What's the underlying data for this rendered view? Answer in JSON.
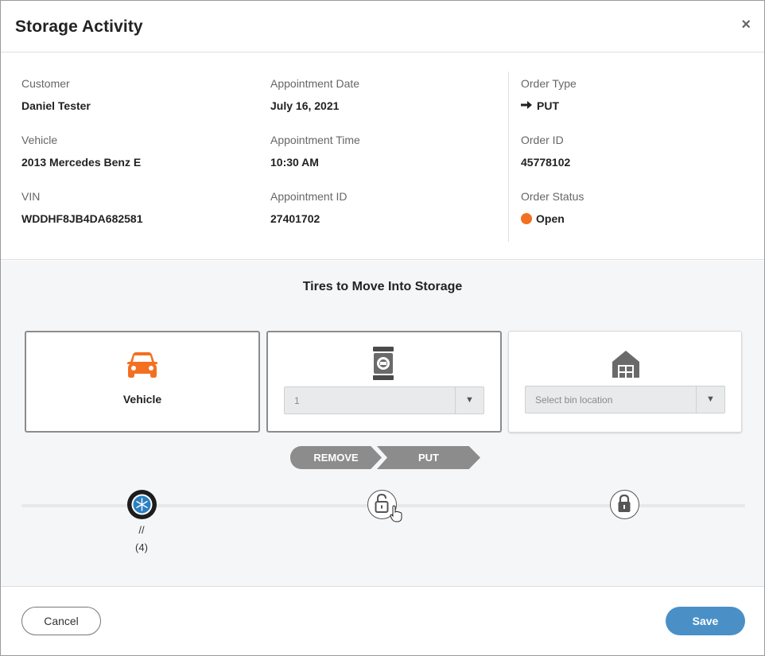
{
  "dialog": {
    "title": "Storage Activity",
    "close_icon": "×"
  },
  "details": {
    "customer_label": "Customer",
    "customer_value": "Daniel Tester",
    "vehicle_label": "Vehicle",
    "vehicle_value": "2013 Mercedes Benz E",
    "vin_label": "VIN",
    "vin_value": "WDDHF8JB4DA682581",
    "appt_date_label": "Appointment Date",
    "appt_date_value": "July 16, 2021",
    "appt_time_label": "Appointment Time",
    "appt_time_value": "10:30 AM",
    "appt_id_label": "Appointment ID",
    "appt_id_value": "27401702",
    "order_type_label": "Order Type",
    "order_type_value": "PUT",
    "order_id_label": "Order ID",
    "order_id_value": "45778102",
    "order_status_label": "Order Status",
    "order_status_value": "Open",
    "status_color": "#f37021"
  },
  "storage": {
    "section_title": "Tires to Move Into Storage",
    "vehicle_card_label": "Vehicle",
    "rack_select_value": "1",
    "bin_select_placeholder": "Select bin location",
    "steps": [
      "REMOVE",
      "PUT"
    ],
    "tire_size": "//",
    "tire_count": "(4)",
    "accent_color": "#f37021"
  },
  "footer": {
    "cancel_label": "Cancel",
    "save_label": "Save",
    "save_color": "#4a90c7"
  },
  "icons": [
    "close-icon",
    "arrow-right-icon",
    "status-dot-icon",
    "car-icon",
    "tire-rack-icon",
    "warehouse-icon",
    "dropdown-arrow-icon",
    "winter-tire-icon",
    "lock-open-icon",
    "lock-icon"
  ]
}
